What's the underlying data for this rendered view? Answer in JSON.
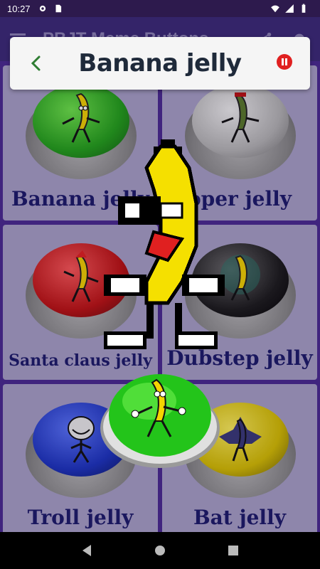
{
  "status_bar": {
    "time": "10:27",
    "icons_left": [
      "gear-icon",
      "sd-card-icon"
    ],
    "icons_right": [
      "wifi-icon",
      "signal-icon",
      "battery-icon"
    ]
  },
  "app_bar": {
    "title": "PBJT Meme Buttons",
    "icons": [
      "menu-icon",
      "share-icon",
      "settings-icon"
    ]
  },
  "popup": {
    "title": "Banana jelly",
    "back_icon": "back-arrow-icon",
    "stop_icon": "pause-icon"
  },
  "cards": [
    {
      "label": "Banana jelly",
      "cap": "green",
      "icon": "banana-icon"
    },
    {
      "label": "oper jelly",
      "cap": "gray",
      "icon": "zombie-banana-icon"
    },
    {
      "label": "Santa claus jelly",
      "cap": "red",
      "icon": "santa-banana-icon"
    },
    {
      "label": "Dubstep jelly",
      "cap": "black",
      "icon": "dubstep-banana-icon"
    },
    {
      "label": "Troll jelly",
      "cap": "blue",
      "icon": "trollface-icon"
    },
    {
      "label": "Bat jelly",
      "cap": "yellow",
      "icon": "bat-banana-icon"
    }
  ],
  "colors": {
    "label_text": "#1c1a6b",
    "app_bar_bg": "#3b2a78",
    "grid_bg": "#4a2a92",
    "card_bg": "#a9a2c8",
    "popup_bg": "#f5f5f5",
    "stop_red": "#e02020",
    "back_green": "#2e7d32"
  },
  "nav_bar": {
    "icons": [
      "back-triangle-icon",
      "home-circle-icon",
      "recents-square-icon"
    ]
  }
}
